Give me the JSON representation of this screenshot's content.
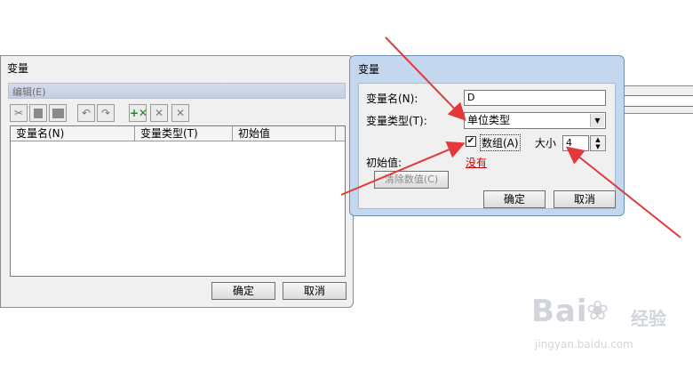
{
  "left_dialog": {
    "title": "变量",
    "menu_label": "编辑(E)",
    "columns": [
      "变量名(N)",
      "变量类型(T)",
      "初始值"
    ],
    "ok_label": "确定",
    "cancel_label": "取消"
  },
  "right_dialog": {
    "title": "变量",
    "name_label": "变量名(N):",
    "name_value": "D",
    "type_label": "变量类型(T):",
    "type_value": "单位类型",
    "array_label": "数组(A)",
    "array_checked": true,
    "size_label": "大小",
    "size_value": "4",
    "init_label": "初始值:",
    "init_value": "没有",
    "clear_label": "清除数值(C)",
    "ok_label": "确定",
    "cancel_label": "取消"
  },
  "watermark": {
    "brand": "Bai",
    "brand_cn": "经验",
    "url": "jingyan.baidu.com"
  },
  "colors": {
    "arrow": "#e23a3a",
    "link": "#cc0000",
    "dialog_frame": "#c3d7ef"
  }
}
